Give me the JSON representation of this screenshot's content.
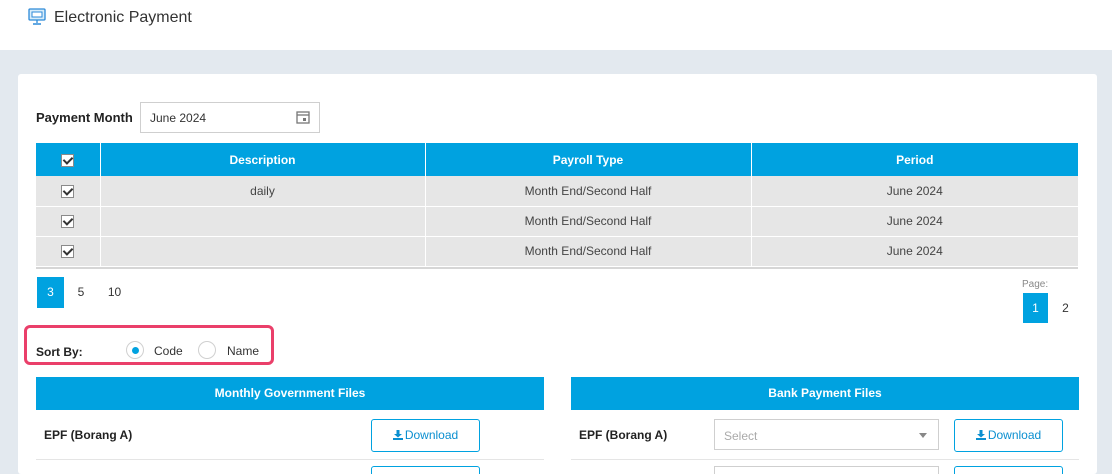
{
  "header": {
    "title": "Electronic Payment",
    "icon": "monitor-payment-icon"
  },
  "filter": {
    "payment_month_label": "Payment Month",
    "payment_month_value": "June 2024",
    "calendar_icon": "calendar-icon"
  },
  "grid": {
    "columns": [
      "Description",
      "Payroll Type",
      "Period"
    ],
    "rows": [
      {
        "description": "daily",
        "payroll_type": "Month End/Second Half",
        "period": "June 2024"
      },
      {
        "description": "",
        "payroll_type": "Month End/Second Half",
        "period": "June 2024"
      },
      {
        "description": "",
        "payroll_type": "Month End/Second Half",
        "period": "June 2024"
      }
    ]
  },
  "page_size": {
    "options": [
      "3",
      "5",
      "10"
    ],
    "selected": "3"
  },
  "pagination": {
    "label": "Page:",
    "pages": [
      "1",
      "2"
    ],
    "current": "1"
  },
  "sort": {
    "label": "Sort By:",
    "options": [
      "Code",
      "Name"
    ],
    "selected": "Code"
  },
  "government_panel": {
    "title": "Monthly Government Files",
    "rows": [
      {
        "label": "EPF (Borang A)",
        "button": "Download"
      }
    ]
  },
  "bank_panel": {
    "title": "Bank Payment Files",
    "rows": [
      {
        "label": "EPF (Borang A)",
        "select_placeholder": "Select",
        "button": "Download"
      }
    ]
  },
  "colors": {
    "accent": "#00a2e0",
    "highlight": "#ea3f6a",
    "background": "#e3e9ef"
  }
}
